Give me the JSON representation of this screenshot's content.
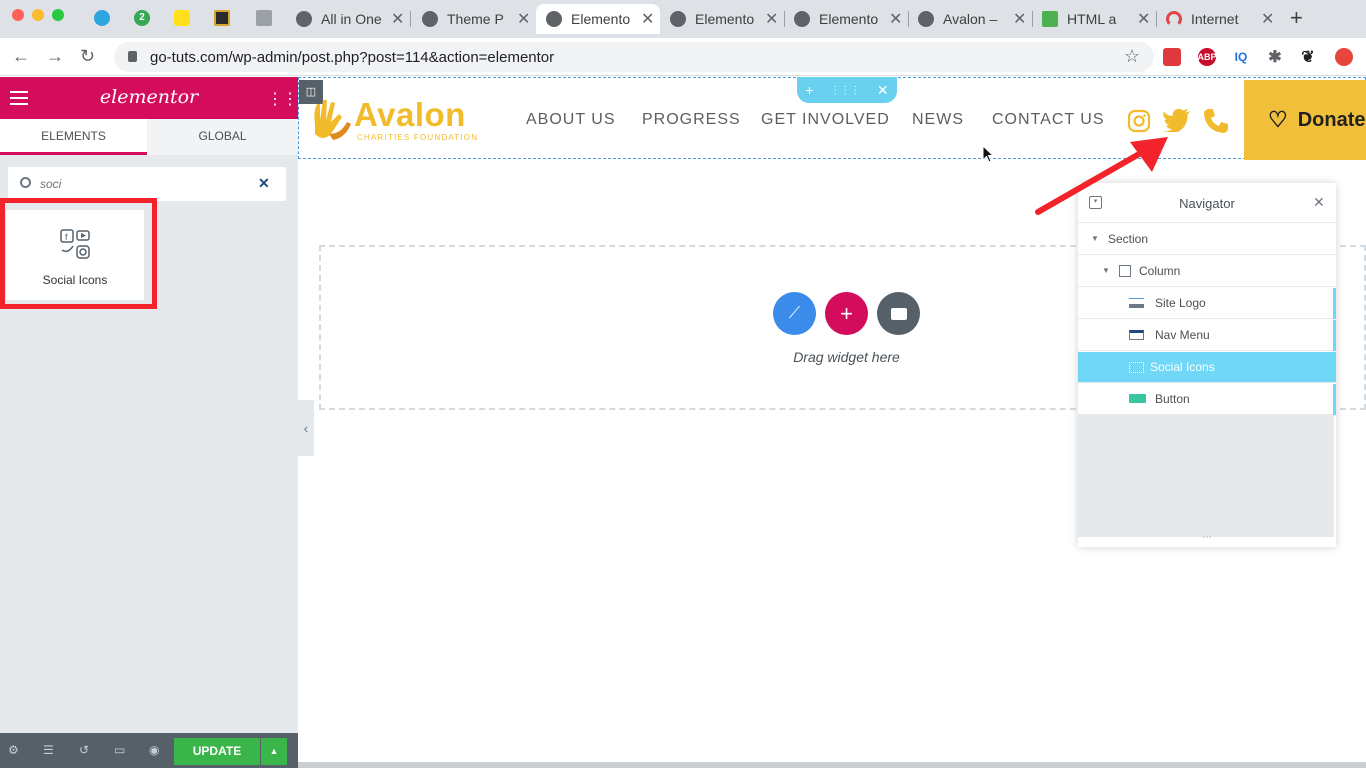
{
  "browser": {
    "tabs": [
      {
        "label": "All in One"
      },
      {
        "label": "Theme P"
      },
      {
        "label": "Elemento",
        "active": true
      },
      {
        "label": "Elemento"
      },
      {
        "label": "Elemento"
      },
      {
        "label": "Avalon –"
      },
      {
        "label": "HTML a"
      },
      {
        "label": "Internet"
      }
    ],
    "pinned_badge": "2",
    "new_tab": "+",
    "url": "go-tuts.com/wp-admin/post.php?post=114&action=elementor",
    "extensions": [
      "ABP",
      "IQ"
    ]
  },
  "panel": {
    "brand": "elementor",
    "tabs": {
      "elements": "ELEMENTS",
      "global": "GLOBAL"
    },
    "search_value": "soci",
    "widget_label": "Social Icons",
    "update_label": "UPDATE"
  },
  "site": {
    "logo_text": "Avalon",
    "logo_sub": "CHARITIES FOUNDATION",
    "menu": [
      "ABOUT US",
      "PROGRESS",
      "GET INVOLVED",
      "NEWS",
      "CONTACT US"
    ],
    "donate_label": "Donate"
  },
  "canvas": {
    "drag_text": "Drag widget here"
  },
  "navigator": {
    "title": "Navigator",
    "items": [
      {
        "label": "Section"
      },
      {
        "label": "Column"
      },
      {
        "label": "Site Logo"
      },
      {
        "label": "Nav Menu"
      },
      {
        "label": "Social Icons",
        "selected": true
      },
      {
        "label": "Button"
      }
    ]
  },
  "colors": {
    "elementor_brand": "#d30c5c",
    "avalon_gold": "#f2bb2c",
    "selection_blue": "#71d7f7",
    "highlight_red": "#f2232b"
  }
}
